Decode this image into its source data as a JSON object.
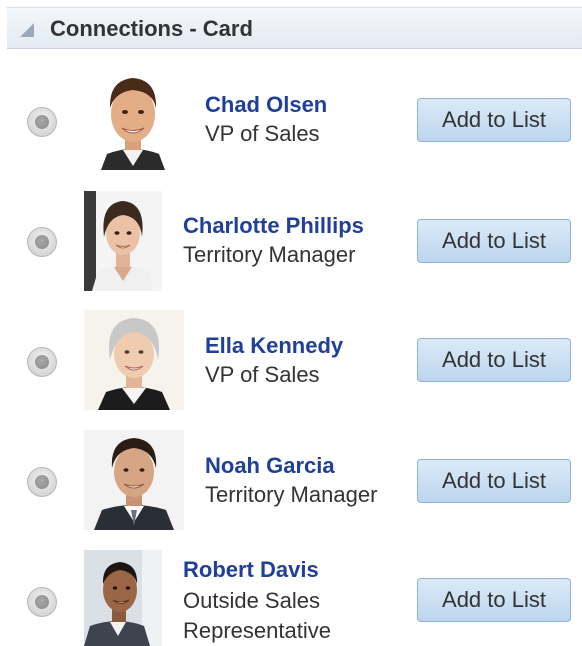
{
  "panel": {
    "title": "Connections - Card"
  },
  "connections": [
    {
      "name": "Chad Olsen",
      "title": "VP of Sales",
      "button_label": "Add to List",
      "avatar": "man-smiling-portrait"
    },
    {
      "name": "Charlotte Phillips",
      "title": "Territory Manager",
      "button_label": "Add to List",
      "avatar": "woman-dark-hair-portrait"
    },
    {
      "name": "Ella Kennedy",
      "title": "VP of Sales",
      "button_label": "Add to List",
      "avatar": "woman-gray-hair-portrait"
    },
    {
      "name": "Noah Garcia",
      "title": "Territory Manager",
      "button_label": "Add to List",
      "avatar": "man-suit-portrait"
    },
    {
      "name": "Robert Davis",
      "title": "Outside Sales Representative",
      "title_lines": [
        "Outside Sales",
        "Representative"
      ],
      "button_label": "Add to List",
      "avatar": "man-side-portrait"
    }
  ],
  "colors": {
    "name_link": "#1f3f9a",
    "button_fill": "#c8dcf2",
    "button_border": "#8fb2d6",
    "header_bg": "#e8eef5"
  }
}
